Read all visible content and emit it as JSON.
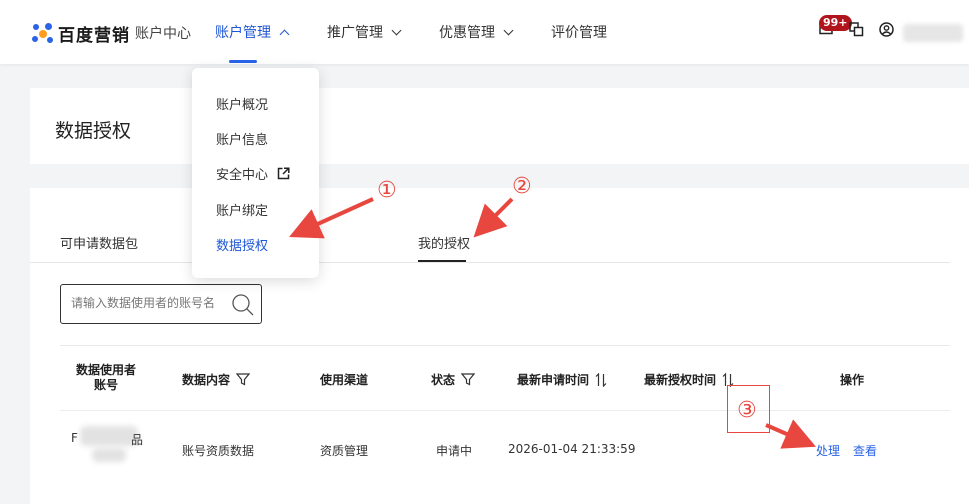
{
  "header": {
    "brand": "百度营销",
    "subtitle": "账户中心",
    "nav": [
      {
        "label": "账户管理"
      },
      {
        "label": "推广管理"
      },
      {
        "label": "优惠管理"
      },
      {
        "label": "评价管理"
      }
    ],
    "notification_badge": "99+"
  },
  "dropdown": {
    "items": [
      "账户概况",
      "账户信息",
      "安全中心",
      "账户绑定",
      "数据授权"
    ]
  },
  "page": {
    "title": "数据授权"
  },
  "tabs": [
    "可申请数据包",
    "我的授权"
  ],
  "search": {
    "placeholder": "请输入数据使用者的账号名"
  },
  "table": {
    "columns": [
      "数据使用者\n账号",
      "数据内容",
      "使用渠道",
      "状态",
      "最新申请时间",
      "最新授权时间",
      "操作"
    ],
    "rows": [
      {
        "account_prefix": "F",
        "account_suffix": "品",
        "content": "账号资质数据",
        "channel": "资质管理",
        "status": "申请中",
        "apply_time": "2026-01-04 21:33:59",
        "auth_time": "",
        "actions": [
          "处理",
          "查看"
        ]
      }
    ]
  },
  "annotations": [
    "①",
    "②",
    "③"
  ],
  "colors": {
    "accent": "#2a63e8",
    "annotation": "#e8473f",
    "badge": "#b0151c"
  }
}
